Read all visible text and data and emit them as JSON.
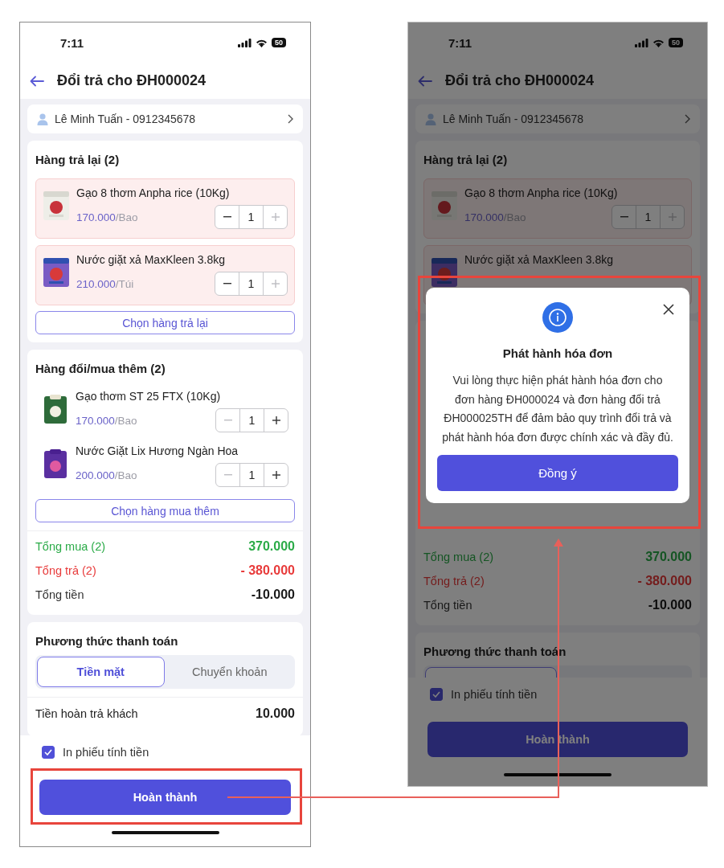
{
  "screens": [
    {
      "status": {
        "time": "7:11",
        "battery": "50"
      },
      "title": "Đổi trả cho ĐH000024",
      "customer": "Lê Minh Tuấn - 0912345678",
      "returns": {
        "heading": "Hàng trả lại (2)",
        "items": [
          {
            "name": "Gạo 8 thơm Anpha rice (10Kg)",
            "price": "170.000",
            "unit": "/Bao",
            "qty": "1",
            "minus_disabled": false,
            "plus_disabled": true
          },
          {
            "name": "Nước giặt xả MaxKleen 3.8kg",
            "price": "210.000",
            "unit": "/Túi",
            "qty": "1",
            "minus_disabled": false,
            "plus_disabled": true
          }
        ],
        "add_button": "Chọn hàng trả lại"
      },
      "exchanges": {
        "heading": "Hàng đổi/mua thêm (2)",
        "items": [
          {
            "name": "Gạo thơm ST 25 FTX (10Kg)",
            "price": "170.000",
            "unit": "/Bao",
            "qty": "1",
            "minus_disabled": true,
            "plus_disabled": false
          },
          {
            "name": "Nước Giặt Lix Hương Ngàn Hoa",
            "price": "200.000",
            "unit": "/Bao",
            "qty": "1",
            "minus_disabled": true,
            "plus_disabled": false
          }
        ],
        "add_button": "Chọn hàng mua thêm"
      },
      "totals": [
        {
          "kind": "buy",
          "label": "Tổng mua (2)",
          "value": "370.000"
        },
        {
          "kind": "return",
          "label": "Tổng trả (2)",
          "value": "- 380.000"
        },
        {
          "kind": "total",
          "label": "Tổng tiền",
          "value": "-10.000"
        }
      ],
      "payment": {
        "heading": "Phương thức thanh toán",
        "methods": [
          {
            "label": "Tiền mặt",
            "selected": true
          },
          {
            "label": "Chuyển khoản",
            "selected": false
          }
        ],
        "refund": {
          "label": "Tiền hoàn trả khách",
          "value": "10.000"
        }
      },
      "print_receipt": {
        "label": "In phiếu tính tiền",
        "checked": true
      },
      "complete_button": "Hoàn thành"
    },
    {
      "status": {
        "time": "7:11",
        "battery": "50"
      },
      "title": "Đổi trả cho ĐH000024",
      "customer": "Lê Minh Tuấn - 0912345678",
      "returns": {
        "heading": "Hàng trả lại (2)",
        "items": [
          {
            "name": "Gạo 8 thơm Anpha rice (10Kg)",
            "price": "170.000",
            "unit": "/Bao",
            "qty": "1",
            "minus_disabled": false,
            "plus_disabled": true
          },
          {
            "name": "Nước giặt xả MaxKleen 3.8kg"
          }
        ]
      },
      "totals": [
        {
          "kind": "buy",
          "label": "Tổng mua (2)",
          "value": "370.000"
        },
        {
          "kind": "return",
          "label": "Tổng trả (2)",
          "value": "- 380.000"
        },
        {
          "kind": "total",
          "label": "Tổng tiền",
          "value": "-10.000"
        }
      ],
      "payment": {
        "heading": "Phương thức thanh toán",
        "methods": [
          {
            "selected": true
          }
        ]
      },
      "print_receipt": {
        "label": "In phiếu tính tiền",
        "checked": true
      },
      "complete_button": "Hoàn thành",
      "dialog": {
        "title": "Phát hành hóa đơn",
        "message": "Vui lòng thực hiện phát hành hóa đơn cho đơn hàng ĐH000024 và đơn hàng đổi trả ĐH000025TH để đảm bảo quy trình đổi trả và phát hành hóa đơn được chính xác và đầy đủ.",
        "confirm_button": "Đồng ý"
      }
    }
  ]
}
